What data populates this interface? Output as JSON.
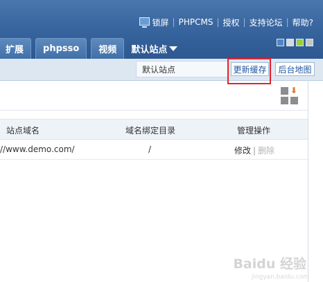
{
  "header": {
    "links": [
      {
        "label": "锁屏",
        "icon": "monitor-icon"
      },
      {
        "label": "PHPCMS"
      },
      {
        "label": "授权"
      },
      {
        "label": "支持论坛"
      },
      {
        "label": "帮助?"
      }
    ],
    "nav_tabs": [
      "扩展",
      "phpsso",
      "视频"
    ],
    "site_menu": {
      "label": "默认站点",
      "icon": "dropdown-triangle-icon"
    },
    "theme_swatches": [
      "#4f86c8",
      "#d5d9de",
      "#9ccf3c",
      "#c6c6c6"
    ]
  },
  "subbar": {
    "current_site": "默认站点",
    "refresh_cache_label": "更新缓存",
    "site_map_label": "后台地图",
    "highlight_color": "#e3232a"
  },
  "table": {
    "columns": [
      "站点域名",
      "域名绑定目录",
      "管理操作"
    ],
    "rows": [
      {
        "domain": "//www.demo.com/",
        "dir": "/",
        "edit": "修改",
        "separator": "|",
        "delete": "删除"
      }
    ]
  },
  "watermark": {
    "text": "Baidu 经验",
    "sub": "jingyan.baidu.com"
  }
}
